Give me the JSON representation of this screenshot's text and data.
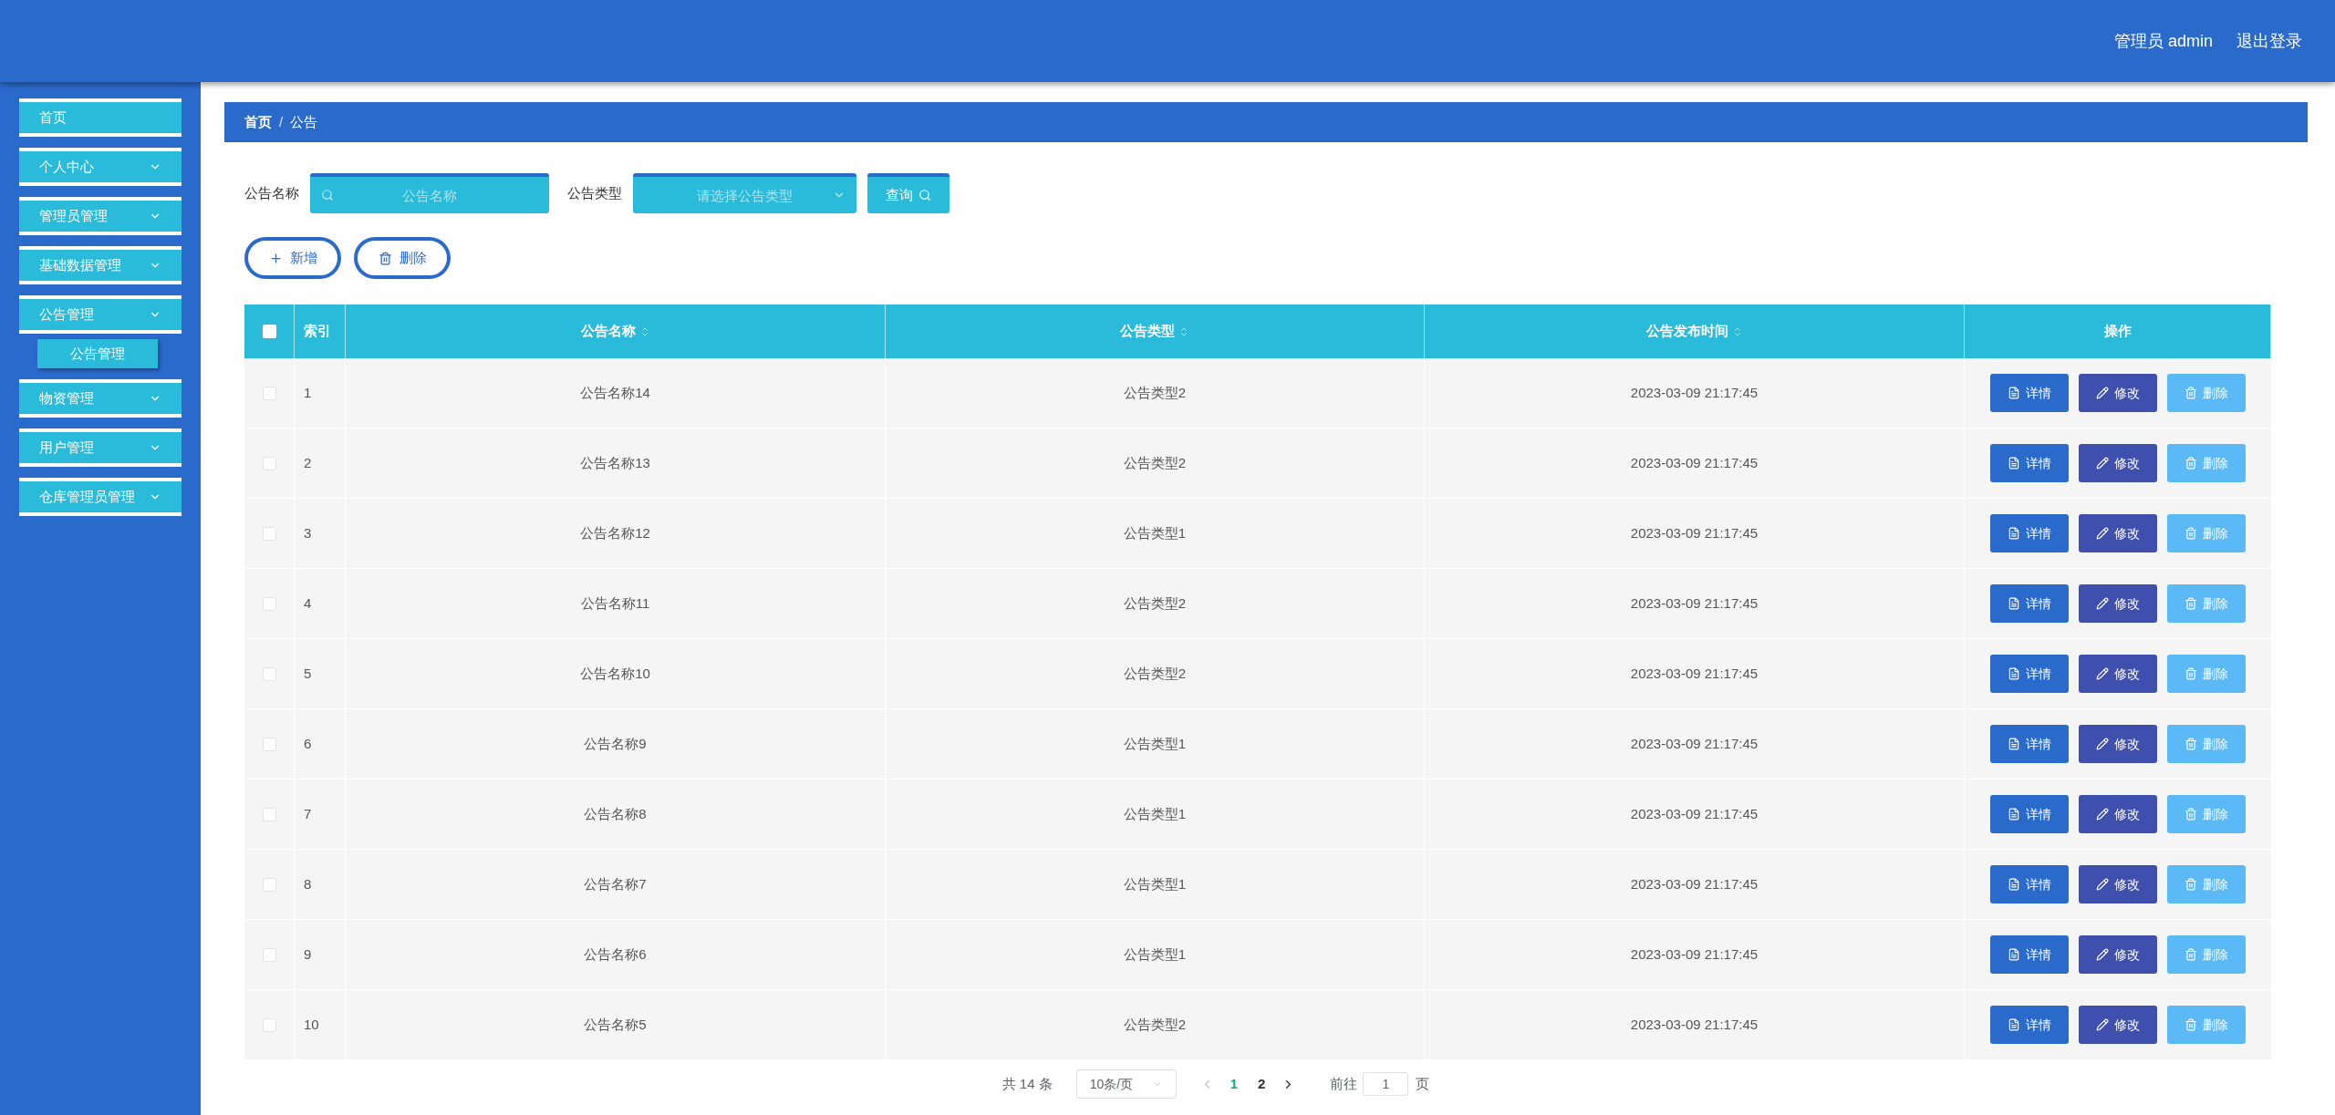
{
  "header": {
    "user": "管理员 admin",
    "logout": "退出登录"
  },
  "sidebar": {
    "items": [
      {
        "kind": "link",
        "label": "首页"
      },
      {
        "kind": "group",
        "label": "个人中心"
      },
      {
        "kind": "group",
        "label": "管理员管理"
      },
      {
        "kind": "group",
        "label": "基础数据管理"
      },
      {
        "kind": "group",
        "label": "公告管理",
        "children": [
          {
            "label": "公告管理",
            "selected": true
          }
        ]
      },
      {
        "kind": "group",
        "label": "物资管理"
      },
      {
        "kind": "group",
        "label": "用户管理"
      },
      {
        "kind": "group",
        "label": "仓库管理员管理"
      }
    ]
  },
  "breadcrumb": {
    "items": [
      "首页",
      "公告"
    ],
    "separator": "/"
  },
  "search": {
    "name_label": "公告名称",
    "name_placeholder": "公告名称",
    "type_label": "公告类型",
    "type_placeholder": "请选择公告类型",
    "query_button": "查询"
  },
  "actions": {
    "add": "新增",
    "delete": "删除"
  },
  "table": {
    "header_checked": false,
    "columns": [
      {
        "label": "索引",
        "kind": "plain"
      },
      {
        "label": "公告名称",
        "kind": "sortable"
      },
      {
        "label": "公告类型",
        "kind": "sortable"
      },
      {
        "label": "公告发布时间",
        "kind": "sortable"
      },
      {
        "label": "操作",
        "kind": "plain"
      }
    ],
    "rows": [
      {
        "checked": false,
        "index": "1",
        "name": "公告名称14",
        "type": "公告类型2",
        "time": "2023-03-09 21:17:45",
        "buttons": [
          "详情",
          "修改",
          "删除"
        ]
      },
      {
        "checked": false,
        "index": "2",
        "name": "公告名称13",
        "type": "公告类型2",
        "time": "2023-03-09 21:17:45",
        "buttons": [
          "详情",
          "修改",
          "删除"
        ]
      },
      {
        "checked": false,
        "index": "3",
        "name": "公告名称12",
        "type": "公告类型1",
        "time": "2023-03-09 21:17:45",
        "buttons": [
          "详情",
          "修改",
          "删除"
        ]
      },
      {
        "checked": false,
        "index": "4",
        "name": "公告名称11",
        "type": "公告类型2",
        "time": "2023-03-09 21:17:45",
        "buttons": [
          "详情",
          "修改",
          "删除"
        ]
      },
      {
        "checked": false,
        "index": "5",
        "name": "公告名称10",
        "type": "公告类型2",
        "time": "2023-03-09 21:17:45",
        "buttons": [
          "详情",
          "修改",
          "删除"
        ]
      },
      {
        "checked": false,
        "index": "6",
        "name": "公告名称9",
        "type": "公告类型1",
        "time": "2023-03-09 21:17:45",
        "buttons": [
          "详情",
          "修改",
          "删除"
        ]
      },
      {
        "checked": false,
        "index": "7",
        "name": "公告名称8",
        "type": "公告类型1",
        "time": "2023-03-09 21:17:45",
        "buttons": [
          "详情",
          "修改",
          "删除"
        ]
      },
      {
        "checked": false,
        "index": "8",
        "name": "公告名称7",
        "type": "公告类型1",
        "time": "2023-03-09 21:17:45",
        "buttons": [
          "详情",
          "修改",
          "删除"
        ]
      },
      {
        "checked": false,
        "index": "9",
        "name": "公告名称6",
        "type": "公告类型1",
        "time": "2023-03-09 21:17:45",
        "buttons": [
          "详情",
          "修改",
          "删除"
        ]
      },
      {
        "checked": false,
        "index": "10",
        "name": "公告名称5",
        "type": "公告类型2",
        "time": "2023-03-09 21:17:45",
        "buttons": [
          "详情",
          "修改",
          "删除"
        ]
      }
    ]
  },
  "pagination": {
    "total": "共 14 条",
    "page_size": "10条/页",
    "pages": [
      {
        "label": "1",
        "selected": true
      },
      {
        "label": "2",
        "selected": false
      }
    ],
    "goto_label": "前往",
    "goto_value": "1",
    "page_unit": "页"
  }
}
